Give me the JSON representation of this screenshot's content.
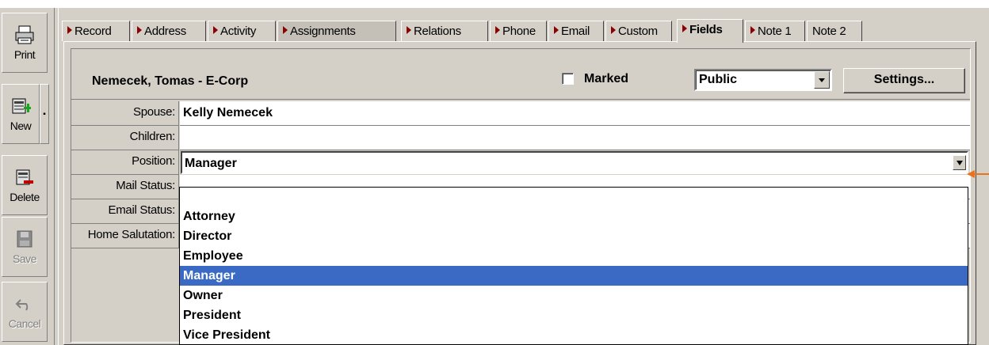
{
  "toolbar": {
    "print_label": "Print",
    "new_label": "New",
    "delete_label": "Delete",
    "save_label": "Save",
    "cancel_label": "Cancel"
  },
  "tabs": [
    {
      "label": "Record",
      "arrow": true
    },
    {
      "label": "Address",
      "arrow": true
    },
    {
      "label": "Activity",
      "arrow": true
    },
    {
      "label": "Assignments",
      "arrow": true
    },
    {
      "label": "Relations",
      "arrow": true
    },
    {
      "label": "Phone",
      "arrow": true
    },
    {
      "label": "Email",
      "arrow": true
    },
    {
      "label": "Custom",
      "arrow": true
    },
    {
      "label": "Fields",
      "arrow": true
    },
    {
      "label": "Note 1",
      "arrow": true
    },
    {
      "label": "Note 2",
      "arrow": false
    }
  ],
  "active_tab": "Fields",
  "header": {
    "contact_name": "Nemecek, Tomas - E-Corp",
    "marked_label": "Marked",
    "marked_checked": false,
    "access_value": "Public",
    "settings_label": "Settings..."
  },
  "fields": [
    {
      "label": "Spouse:",
      "value": "Kelly Nemecek"
    },
    {
      "label": "Children:",
      "value": ""
    },
    {
      "label": "Position:",
      "value": "Manager"
    },
    {
      "label": "Mail Status:",
      "value": ""
    },
    {
      "label": "Email Status:",
      "value": ""
    },
    {
      "label": "Home Salutation:",
      "value": ""
    }
  ],
  "position_options": [
    "Attorney",
    "Director",
    "Employee",
    "Manager",
    "Owner",
    "President",
    "Vice President"
  ],
  "position_selected": "Manager",
  "colors": {
    "window_bg": "#d4d0c8",
    "selection_bg": "#3a6ac4",
    "tab_arrow": "#8b0000",
    "annotation_arrow": "#e8731c"
  }
}
